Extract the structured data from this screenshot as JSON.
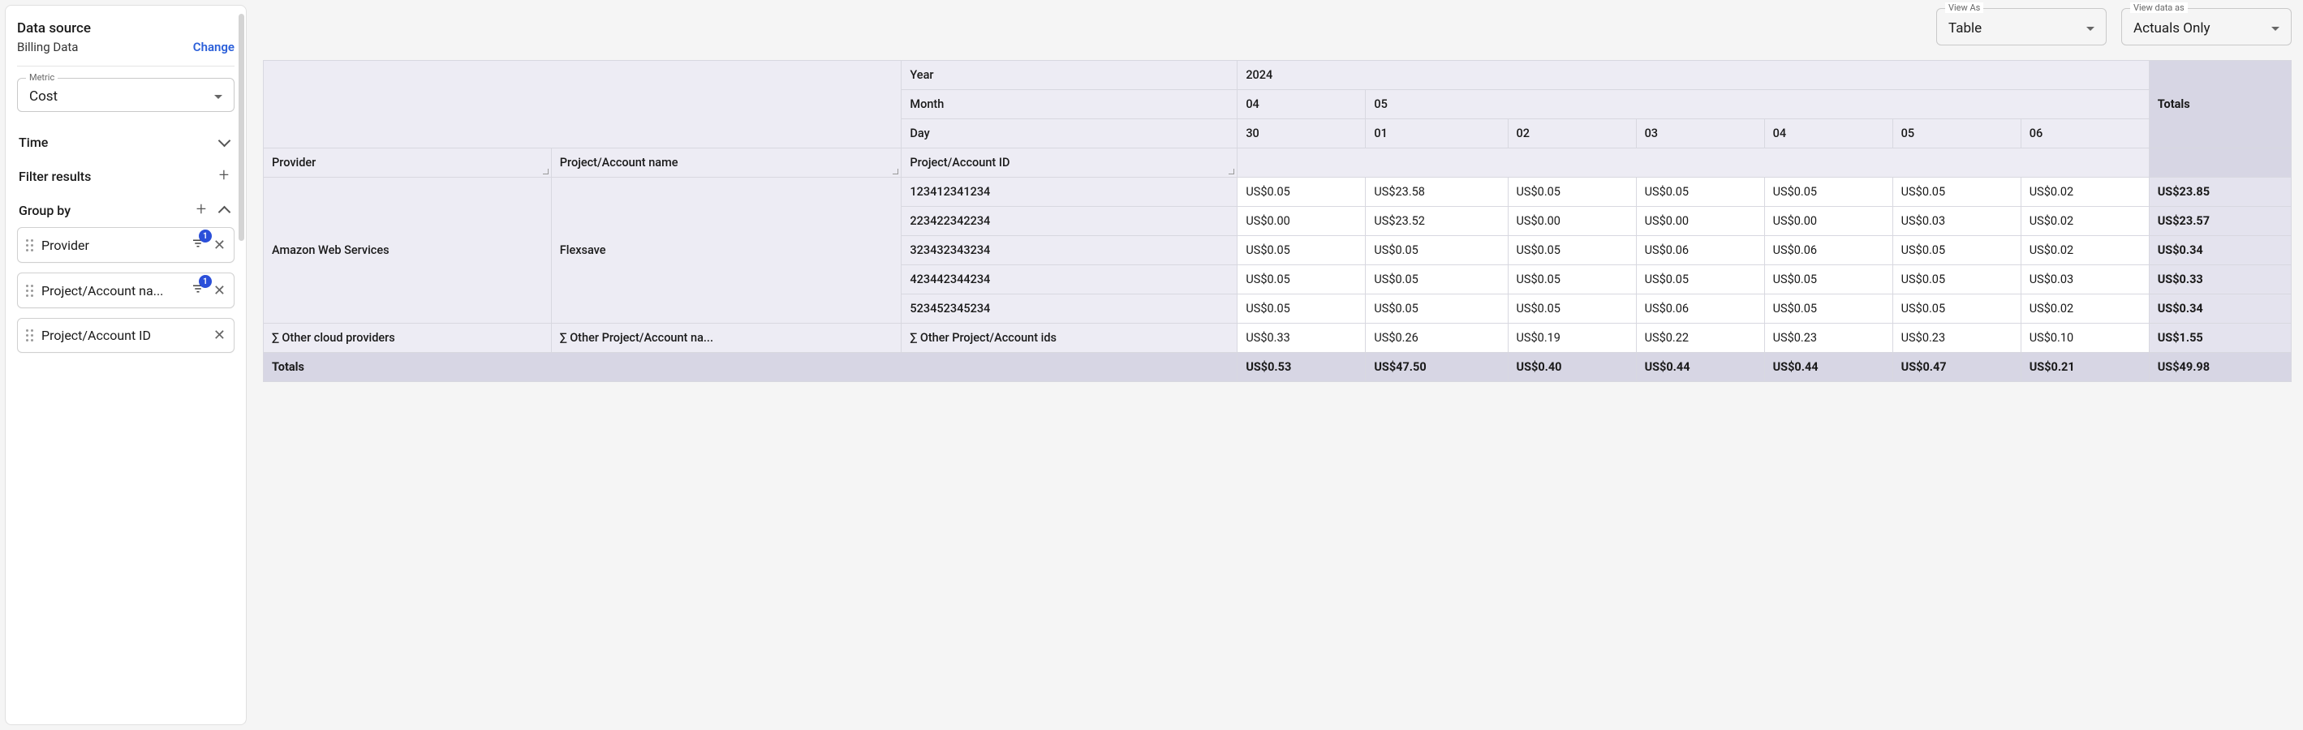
{
  "sidebar": {
    "data_source_title": "Data source",
    "data_source_value": "Billing Data",
    "change_label": "Change",
    "metric_label": "Metric",
    "metric_value": "Cost",
    "time_label": "Time",
    "filter_results_label": "Filter results",
    "group_by_label": "Group by",
    "group_items": [
      {
        "label": "Provider",
        "badge": "1",
        "has_filter": true
      },
      {
        "label": "Project/Account na...",
        "badge": "1",
        "has_filter": true
      },
      {
        "label": "Project/Account ID",
        "badge": null,
        "has_filter": false
      }
    ]
  },
  "toolbar": {
    "view_as_label": "View As",
    "view_as_value": "Table",
    "view_data_label": "View data as",
    "view_data_value": "Actuals Only"
  },
  "table": {
    "year_label": "Year",
    "year_value": "2024",
    "month_label": "Month",
    "months": [
      "04",
      "05"
    ],
    "day_label": "Day",
    "days": [
      "30",
      "01",
      "02",
      "03",
      "04",
      "05",
      "06"
    ],
    "col_headers": [
      "Provider",
      "Project/Account name",
      "Project/Account ID"
    ],
    "totals_header": "Totals",
    "rows": [
      {
        "provider": "Amazon Web Services",
        "account_name": "Flexsave",
        "account_id": "123412341234",
        "values": [
          "US$0.05",
          "US$23.58",
          "US$0.05",
          "US$0.05",
          "US$0.05",
          "US$0.05",
          "US$0.02"
        ],
        "total": "US$23.85"
      },
      {
        "provider": "",
        "account_name": "",
        "account_id": "223422342234",
        "values": [
          "US$0.00",
          "US$23.52",
          "US$0.00",
          "US$0.00",
          "US$0.00",
          "US$0.03",
          "US$0.02"
        ],
        "total": "US$23.57"
      },
      {
        "provider": "",
        "account_name": "",
        "account_id": "323432343234",
        "values": [
          "US$0.05",
          "US$0.05",
          "US$0.05",
          "US$0.06",
          "US$0.06",
          "US$0.05",
          "US$0.02"
        ],
        "total": "US$0.34"
      },
      {
        "provider": "",
        "account_name": "",
        "account_id": "423442344234",
        "values": [
          "US$0.05",
          "US$0.05",
          "US$0.05",
          "US$0.05",
          "US$0.05",
          "US$0.05",
          "US$0.03"
        ],
        "total": "US$0.33"
      },
      {
        "provider": "",
        "account_name": "",
        "account_id": "523452345234",
        "values": [
          "US$0.05",
          "US$0.05",
          "US$0.05",
          "US$0.06",
          "US$0.05",
          "US$0.05",
          "US$0.02"
        ],
        "total": "US$0.34"
      }
    ],
    "other_row": {
      "provider": "∑ Other cloud providers",
      "account_name": "∑ Other Project/Account na...",
      "account_id": "∑ Other Project/Account ids",
      "values": [
        "US$0.33",
        "US$0.26",
        "US$0.19",
        "US$0.22",
        "US$0.23",
        "US$0.23",
        "US$0.10"
      ],
      "total": "US$1.55"
    },
    "totals_row": {
      "label": "Totals",
      "values": [
        "US$0.53",
        "US$47.50",
        "US$0.40",
        "US$0.44",
        "US$0.44",
        "US$0.47",
        "US$0.21"
      ],
      "total": "US$49.98"
    }
  },
  "chart_data": {
    "type": "table",
    "title": "Billing Data — Cost",
    "columns": [
      "Provider",
      "Project/Account name",
      "Project/Account ID",
      "2024-04-30",
      "2024-05-01",
      "2024-05-02",
      "2024-05-03",
      "2024-05-04",
      "2024-05-05",
      "2024-05-06",
      "Totals"
    ],
    "rows": [
      [
        "Amazon Web Services",
        "Flexsave",
        "123412341234",
        0.05,
        23.58,
        0.05,
        0.05,
        0.05,
        0.05,
        0.02,
        23.85
      ],
      [
        "Amazon Web Services",
        "Flexsave",
        "223422342234",
        0.0,
        23.52,
        0.0,
        0.0,
        0.0,
        0.03,
        0.02,
        23.57
      ],
      [
        "Amazon Web Services",
        "Flexsave",
        "323432343234",
        0.05,
        0.05,
        0.05,
        0.06,
        0.06,
        0.05,
        0.02,
        0.34
      ],
      [
        "Amazon Web Services",
        "Flexsave",
        "423442344234",
        0.05,
        0.05,
        0.05,
        0.05,
        0.05,
        0.05,
        0.03,
        0.33
      ],
      [
        "Amazon Web Services",
        "Flexsave",
        "523452345234",
        0.05,
        0.05,
        0.05,
        0.06,
        0.05,
        0.05,
        0.02,
        0.34
      ],
      [
        "∑ Other cloud providers",
        "∑ Other Project/Account names",
        "∑ Other Project/Account ids",
        0.33,
        0.26,
        0.19,
        0.22,
        0.23,
        0.23,
        0.1,
        1.55
      ]
    ],
    "totals": [
      0.53,
      47.5,
      0.4,
      0.44,
      0.44,
      0.47,
      0.21,
      49.98
    ],
    "currency": "US$"
  }
}
